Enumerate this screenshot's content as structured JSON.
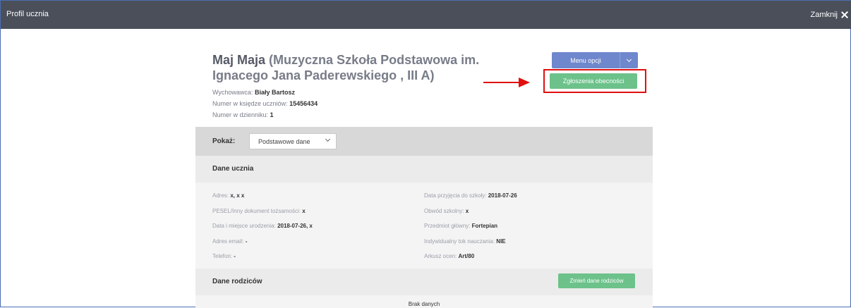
{
  "window": {
    "title": "Profil ucznia",
    "close_label": "Zamknij"
  },
  "student": {
    "name": "Maj Maja",
    "school_class": "(Muzyczna Szkoła Podstawowa im. Ignacego Jana Paderewskiego , III A)",
    "tutor_label": "Wychowawca:",
    "tutor_value": "Biały Bartosz",
    "register_number_label": "Numer w księdze uczniów:",
    "register_number_value": "15456434",
    "journal_number_label": "Numer w dzienniku:",
    "journal_number_value": "1"
  },
  "actions": {
    "menu_label": "Menu opcji",
    "attendance_label": "Zgłoszenia obecności"
  },
  "show": {
    "label": "Pokaż:",
    "selected": "Podstawowe dane"
  },
  "student_data": {
    "title": "Dane ucznia",
    "left": [
      {
        "label": "Adres:",
        "value": "x, x x"
      },
      {
        "label": "PESEL/Inny dokument tożsamości:",
        "value": "x"
      },
      {
        "label": "Data i miejsce urodzenia:",
        "value": "2018-07-26, x"
      },
      {
        "label": "Adres email:",
        "value": "-"
      },
      {
        "label": "Telefon:",
        "value": "-"
      }
    ],
    "right": [
      {
        "label": "Data przyjęcia do szkoły:",
        "value": "2018-07-26"
      },
      {
        "label": "Obwód szkolny:",
        "value": "x"
      },
      {
        "label": "Przedmiot główny:",
        "value": "Fortepian"
      },
      {
        "label": "Indywidualny tok nauczania:",
        "value": "NIE"
      },
      {
        "label": "Arkusz ocen:",
        "value": "Art/80"
      }
    ]
  },
  "parents": {
    "title": "Dane rodziców",
    "change_label": "Zmień dane rodziców",
    "empty_text": "Brak danych"
  },
  "colors": {
    "topbar": "#4a4f5a",
    "menu_button": "#6f87cc",
    "green_button": "#6cc28a",
    "highlight": "#e01010"
  }
}
